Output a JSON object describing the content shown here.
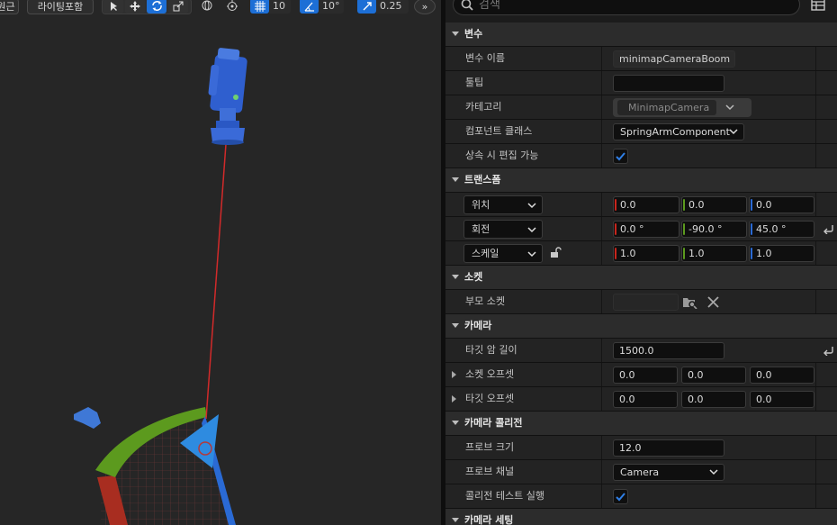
{
  "toolbar": {
    "view_btn": "원근",
    "lighting_btn": "라이팅포함",
    "grid_snap": "10",
    "rot_snap": "10°",
    "scale_snap": "0.25",
    "more": "»"
  },
  "search": {
    "placeholder": "검색"
  },
  "details": {
    "cat_variable": "변수",
    "var_name_label": "변수 이름",
    "var_name_value": "minimapCameraBoom",
    "tooltip_label": "툴팁",
    "tooltip_value": "",
    "category_label": "카테고리",
    "category_value": "MinimapCamera",
    "component_class_label": "컴포넌트 클래스",
    "component_class_value": "SpringArmComponent",
    "editable_inherit_label": "상속 시 편집 가능",
    "editable_inherit_checked": true,
    "cat_transform": "트랜스폼",
    "location_label": "위치",
    "location": [
      "0.0",
      "0.0",
      "0.0"
    ],
    "rotation_label": "회전",
    "rotation": [
      "0.0 °",
      "-90.0 °",
      "45.0 °"
    ],
    "scale_label": "스케일",
    "scale": [
      "1.0",
      "1.0",
      "1.0"
    ],
    "cat_socket": "소켓",
    "parent_socket_label": "부모 소켓",
    "parent_socket_value": "",
    "cat_camera": "카메라",
    "target_arm_length_label": "타깃 암 길이",
    "target_arm_length": "1500.0",
    "socket_offset_label": "소켓 오프셋",
    "socket_offset": [
      "0.0",
      "0.0",
      "0.0"
    ],
    "target_offset_label": "타깃 오프셋",
    "target_offset": [
      "0.0",
      "0.0",
      "0.0"
    ],
    "cat_camera_collision": "카메라 콜리전",
    "probe_size_label": "프로브 크기",
    "probe_size": "12.0",
    "probe_channel_label": "프로브 채널",
    "probe_channel_value": "Camera",
    "do_collision_test_label": "콜리전 테스트 실행",
    "do_collision_test_checked": true,
    "cat_camera_settings": "카메라 세팅"
  },
  "colors": {
    "x_axis": "#c8251c",
    "y_axis": "#5c9a1e",
    "z_axis": "#2a6ad4",
    "accent": "#1d6fd6"
  }
}
